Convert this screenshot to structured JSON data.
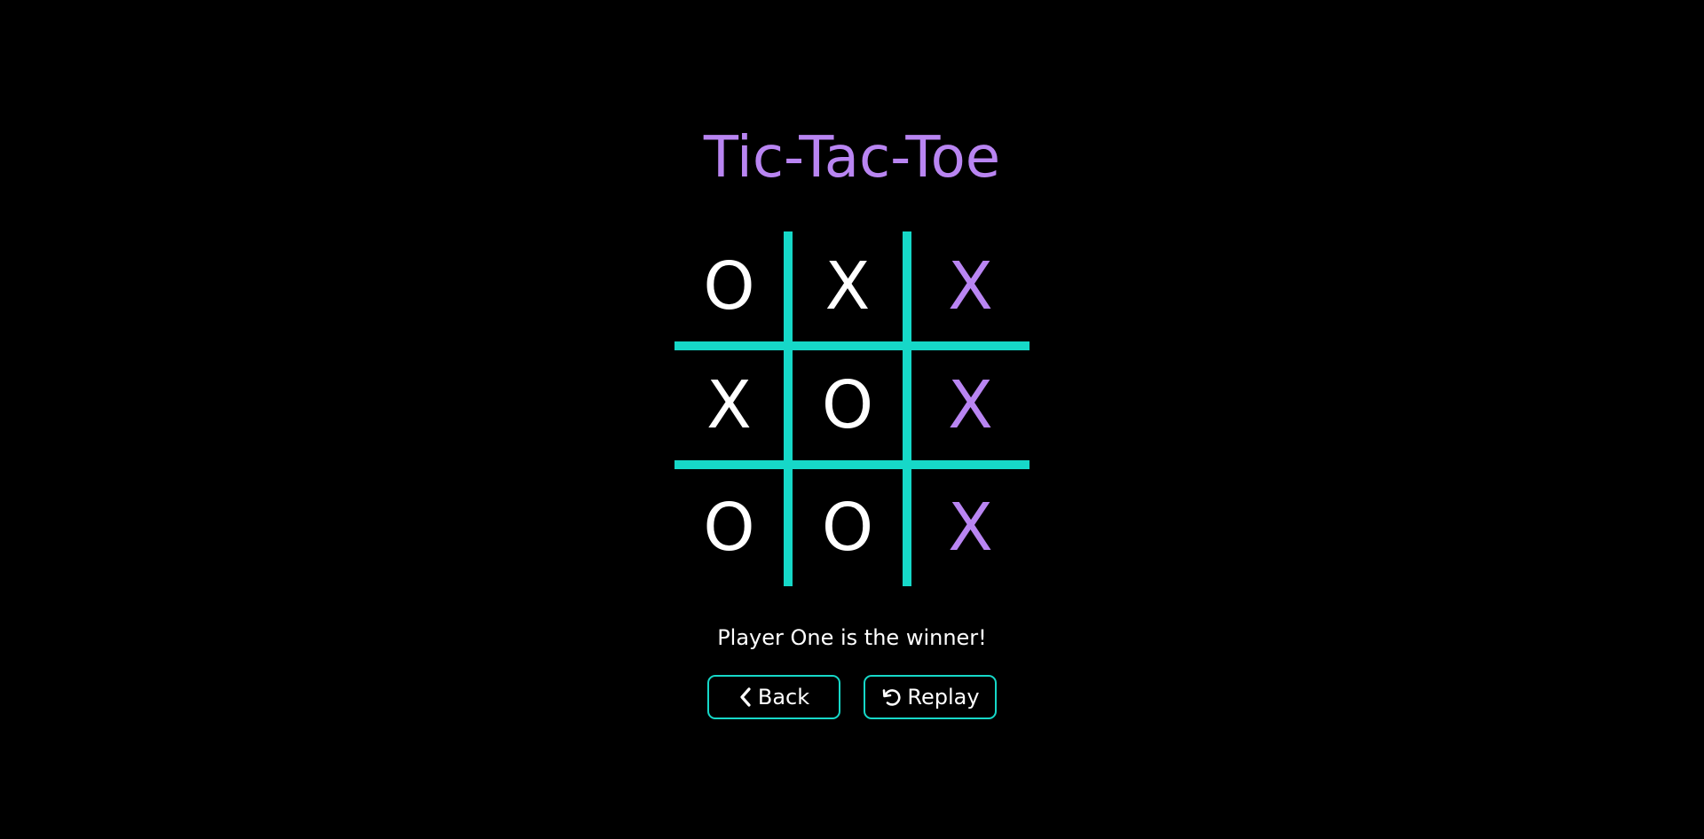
{
  "title": "Tic-Tac-Toe",
  "colors": {
    "background": "#000000",
    "title": "#b985f2",
    "grid": "#16d8c8",
    "mark_default": "#ffffff",
    "mark_winning": "#b985f2",
    "text": "#ffffff",
    "button_border": "#16d8c8"
  },
  "board": {
    "cells": [
      [
        "O",
        "X",
        "X"
      ],
      [
        "X",
        "O",
        "X"
      ],
      [
        "O",
        "O",
        "X"
      ]
    ],
    "winning_cells": [
      [
        0,
        2
      ],
      [
        1,
        2
      ],
      [
        2,
        2
      ]
    ]
  },
  "status": "Player One is the winner!",
  "buttons": {
    "back": {
      "label": "Back",
      "icon": "chevron-left-icon"
    },
    "replay": {
      "label": "Replay",
      "icon": "undo-arrow-icon"
    }
  }
}
